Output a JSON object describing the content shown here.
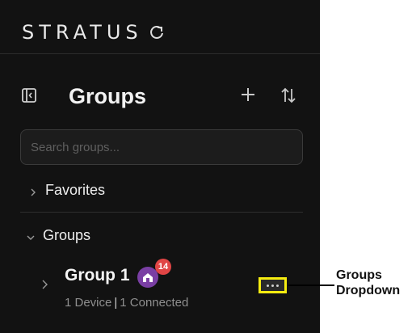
{
  "app": {
    "brand": "STRATUS"
  },
  "groups_panel": {
    "title": "Groups",
    "search_placeholder": "Search groups...",
    "sections": [
      {
        "label": "Favorites",
        "expanded": false
      },
      {
        "label": "Groups",
        "expanded": true
      }
    ],
    "items": [
      {
        "name": "Group 1",
        "badge_count": "14",
        "devices": "1 Device",
        "separator": "|",
        "connected": "1 Connected"
      }
    ]
  },
  "annotation": {
    "callout_line1": "Groups",
    "callout_line2": "Dropdown",
    "highlight_color": "#f5ec10"
  },
  "colors": {
    "panel_bg": "#121212",
    "avatar": "#7a3fa4",
    "badge": "#e04545"
  },
  "icons": [
    "refresh-icon",
    "sidebar-toggle-icon",
    "plus-icon",
    "sort-icon",
    "chevron-right-icon",
    "chevron-down-icon",
    "home-icon",
    "more-icon"
  ]
}
